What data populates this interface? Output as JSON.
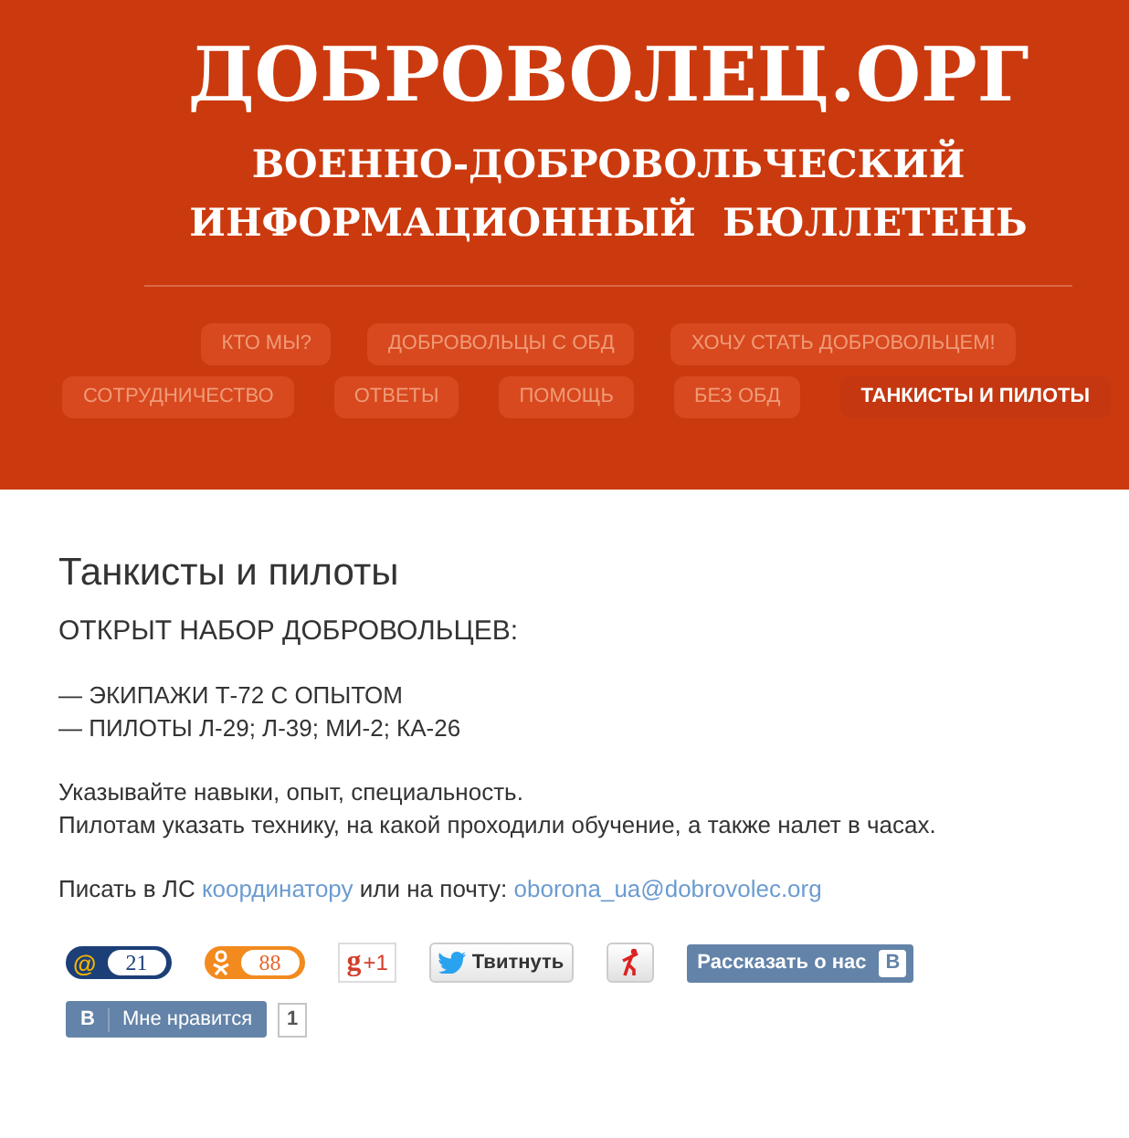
{
  "header": {
    "title": "ДОБРОВОЛЕЦ.ОРГ",
    "subtitle_lines": [
      "ВОЕННО-ДОБРОВОЛЬЧЕСКИЙ",
      "ИНФОРМАЦИОННЫЙ  БЮЛЛЕТЕНЬ"
    ]
  },
  "nav_rows": [
    [
      {
        "label": "КТО МЫ?",
        "selected": false
      },
      {
        "label": "ДОБРОВОЛЬЦЫ С ОБД",
        "selected": false
      },
      {
        "label": "ХОЧУ СТАТЬ ДОБРОВОЛЬЦЕМ!",
        "selected": false
      }
    ],
    [
      {
        "label": "СОТРУДНИЧЕСТВО",
        "selected": false
      },
      {
        "label": "ОТВЕТЫ",
        "selected": false
      },
      {
        "label": "ПОМОЩЬ",
        "selected": false
      },
      {
        "label": "БЕЗ ОБД",
        "selected": false
      },
      {
        "label": "ТАНКИСТЫ И ПИЛОТЫ",
        "selected": true
      }
    ]
  ],
  "content": {
    "heading": "Танкисты и пилоты",
    "lead": "ОТКРЫТ НАБОР ДОБРОВОЛЬЦЕВ:",
    "list_lines": [
      "— ЭКИПАЖИ Т-72 С ОПЫТОМ",
      "— ПИЛОТЫ Л-29; Л-39; МИ-2; КА-26"
    ],
    "notes": [
      "Указывайте навыки, опыт, специальность.",
      "Пилотам указать технику, на какой проходили обучение, а также налет в часах."
    ],
    "contact": {
      "prefix": "Писать в ЛС",
      "link": "координатору",
      "middle": "или на почту:",
      "email": "oborona_ua@dobrovolec.org"
    }
  },
  "social": {
    "mailru": {
      "icon_char": "@",
      "count": "21"
    },
    "odnoklassniki": {
      "count": "88"
    },
    "gplus": {
      "logo": "g",
      "label": "+1"
    },
    "tweet": {
      "label": "Твитнуть"
    },
    "vk_share": {
      "label": "Рассказать о нас",
      "logo": "B"
    },
    "vk_like": {
      "logo": "B",
      "label": "Мне нравится",
      "count": "1"
    }
  }
}
